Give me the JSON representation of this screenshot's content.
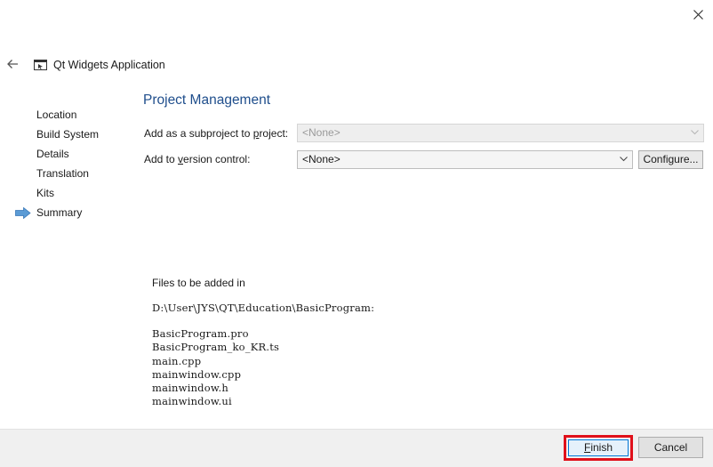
{
  "window": {
    "close_icon": "close-icon"
  },
  "header": {
    "back_icon": "back-arrow-icon",
    "app_icon": "qt-application-icon",
    "title": "Qt Widgets Application"
  },
  "sidebar": {
    "current_indicator_icon": "current-step-arrow-icon",
    "current_indicator_color": "#5b9bd5",
    "items": [
      {
        "label": "Location"
      },
      {
        "label": "Build System"
      },
      {
        "label": "Details"
      },
      {
        "label": "Translation"
      },
      {
        "label": "Kits"
      },
      {
        "label": "Summary",
        "current": true
      }
    ]
  },
  "main": {
    "page_title": "Project Management",
    "page_title_color": "#1f4e8c",
    "subproject": {
      "label_pre": "Add as a subproject to ",
      "label_key": "p",
      "label_post": "roject:",
      "value": "<None>",
      "enabled": false
    },
    "version_control": {
      "label_pre": "Add to ",
      "label_key": "v",
      "label_post": "ersion control:",
      "value": "<None>",
      "enabled": true
    },
    "configure_button": "Configure...",
    "files": {
      "heading": "Files to be added in",
      "path": "D:\\User\\JYS\\QT\\Education\\BasicProgram:",
      "list": [
        "BasicProgram.pro",
        "BasicProgram_ko_KR.ts",
        "main.cpp",
        "mainwindow.cpp",
        "mainwindow.h",
        "mainwindow.ui"
      ]
    }
  },
  "footer": {
    "finish_key": "F",
    "finish_rest": "inish",
    "cancel_label": "Cancel",
    "highlight_color": "#e0101a"
  }
}
